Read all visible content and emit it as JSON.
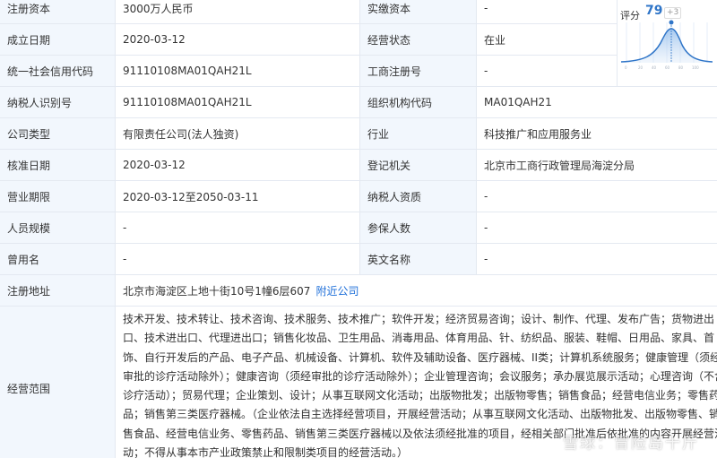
{
  "rows": [
    {
      "l1": "注册资本",
      "v1": "3000万人民币",
      "l2": "实缴资本",
      "v2": "-"
    },
    {
      "l1": "成立日期",
      "v1": "2020-03-12",
      "l2": "经营状态",
      "v2": "在业"
    },
    {
      "l1": "统一社会信用代码",
      "v1": "91110108MA01QAH21L",
      "l2": "工商注册号",
      "v2": "-"
    },
    {
      "l1": "纳税人识别号",
      "v1": "91110108MA01QAH21L",
      "l2": "组织机构代码",
      "v2": "MA01QAH21"
    },
    {
      "l1": "公司类型",
      "v1": "有限责任公司(法人独资)",
      "l2": "行业",
      "v2": "科技推广和应用服务业"
    },
    {
      "l1": "核准日期",
      "v1": "2020-03-12",
      "l2": "登记机关",
      "v2": "北京市工商行政管理局海淀分局"
    },
    {
      "l1": "营业期限",
      "v1": "2020-03-12至2050-03-11",
      "l2": "纳税人资质",
      "v2": "-"
    },
    {
      "l1": "人员规模",
      "v1": "-",
      "l2": "参保人数",
      "v2": "-"
    },
    {
      "l1": "曾用名",
      "v1": "-",
      "l2": "英文名称",
      "v2": "-"
    }
  ],
  "address": {
    "label": "注册地址",
    "value": "北京市海淀区上地十街10号1幢6层607",
    "link": "附近公司"
  },
  "scope": {
    "label": "经营范围",
    "text": "技术开发、技术转让、技术咨询、技术服务、技术推广；软件开发；经济贸易咨询；设计、制作、代理、发布广告；货物进出口、技术进出口、代理进出口；销售化妆品、卫生用品、消毒用品、体育用品、针、纺织品、服装、鞋帽、日用品、家具、首饰、自行开发后的产品、电子产品、机械设备、计算机、软件及辅助设备、医疗器械、II类；计算机系统服务；健康管理（须经审批的诊疗活动除外）；健康咨询（须经审批的诊疗活动除外）；企业管理咨询；会议服务；承办展览展示活动；心理咨询（不含诊疗活动）；贸易代理；企业策划、设计；从事互联网文化活动；出版物批发；出版物零售；销售食品；经营电信业务；零售药品；销售第三类医疗器械。（企业依法自主选择经营项目，开展经营活动；从事互联网文化活动、出版物批发、出版物零售、销售食品、经营电信业务、零售药品、销售第三类医疗器械以及依法须经批准的项目，经相关部门批准后依批准的内容开展经营活动；不得从事本市产业政策禁止和限制类项目的经营活动。）"
  },
  "score": {
    "label": "评分",
    "value": "79",
    "delta": "+3",
    "value_num": 79,
    "accent": "#2f75c8"
  },
  "watermark": "雪球：冒险岛十斤"
}
